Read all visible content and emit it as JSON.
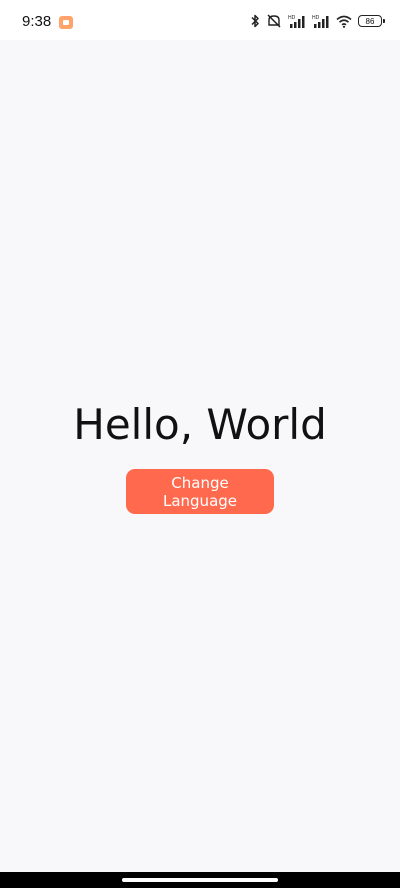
{
  "status_bar": {
    "time": "9:38",
    "battery_level": "86",
    "network_badges": [
      "HD",
      "HD"
    ],
    "notification_icon": "video-app-icon",
    "icons": [
      "bluetooth-icon",
      "silent-icon",
      "signal-icon",
      "signal-icon",
      "wifi-icon",
      "battery-icon"
    ]
  },
  "main": {
    "greeting": "Hello, World",
    "button_label": "Change Language"
  },
  "colors": {
    "background": "#f8f7fa",
    "accent": "#ff6a4f",
    "notification": "#ffa36b"
  }
}
